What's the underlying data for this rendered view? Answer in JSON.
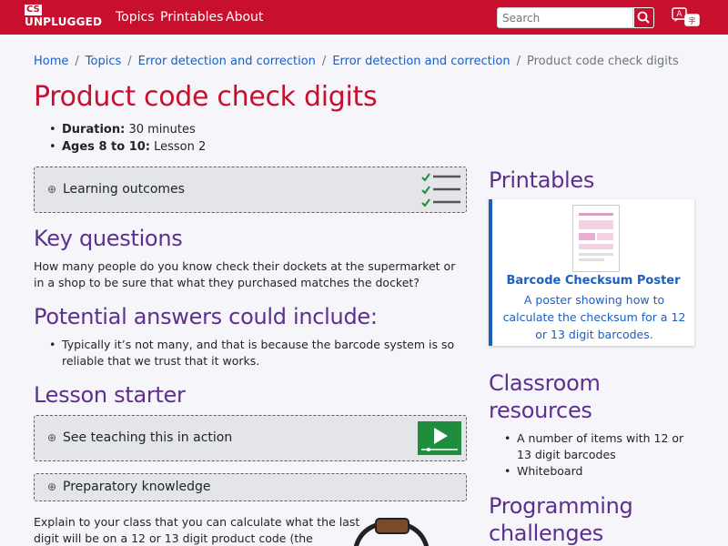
{
  "navbar": {
    "logo_top": "CS",
    "logo_bottom": "UNPLUGGED",
    "links": [
      "Topics",
      "Printables",
      "About"
    ],
    "search_placeholder": "Search",
    "language_icon": "translate-icon"
  },
  "breadcrumb": [
    "Home",
    "Topics",
    "Error detection and correction",
    "Error detection and correction",
    "Product code check digits"
  ],
  "page_title": "Product code check digits",
  "meta": {
    "duration_label": "Duration:",
    "duration_value": "30 minutes",
    "ages_label": "Ages 8 to 10:",
    "ages_value": "Lesson 2"
  },
  "panels": {
    "learning_outcomes": "Learning outcomes",
    "teaching_in_action": "See teaching this in action",
    "preparatory_knowledge": "Preparatory knowledge",
    "toggle_glyph": "⊕"
  },
  "sections": {
    "key_questions": {
      "heading": "Key questions",
      "text": "How many people do you know check their dockets at the supermarket or in a shop to be sure that what they purchased matches the docket?"
    },
    "potential_answers": {
      "heading": "Potential answers could include:",
      "items": [
        "Typically it’s not many, and that is because the barcode system is so reliable that we trust that it works."
      ]
    },
    "lesson_starter": {
      "heading": "Lesson starter",
      "text_line1": "Explain to your class that you can calculate what the last",
      "text_line2": "digit will be on a 12 or 13 digit product code (the"
    }
  },
  "sidebar": {
    "printables_heading": "Printables",
    "printable_card": {
      "title": "Barcode Checksum Poster",
      "description": "A poster showing how to calculate the checksum for a 12 or 13 digit barcodes."
    },
    "classroom_heading_line1": "Classroom",
    "classroom_heading_line2": "resources",
    "classroom_items": [
      "A number of items with 12 or 13 digit barcodes",
      "Whiteboard"
    ],
    "programming_heading_line1": "Programming",
    "programming_heading_line2": "challenges"
  },
  "colors": {
    "brand_red": "#c8102e",
    "heading_purple": "#5d2f8f",
    "link_blue": "#1a5fc1",
    "video_green": "#1e8e3e"
  }
}
